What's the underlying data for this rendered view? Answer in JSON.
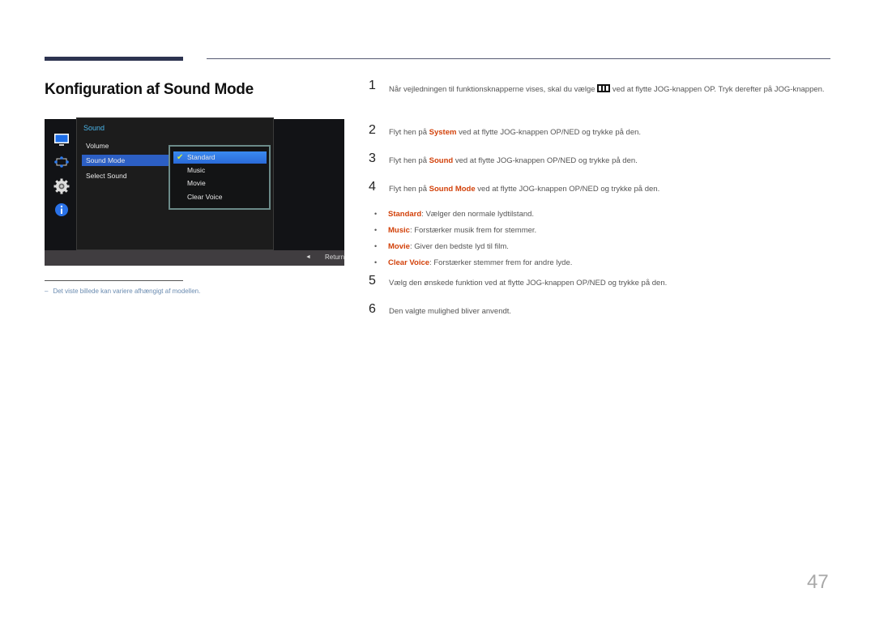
{
  "page": {
    "title": "Konfiguration af Sound Mode",
    "page_number": "47",
    "note": "Det viste billede kan variere afhængigt af modellen.",
    "note_marker": "–"
  },
  "osd": {
    "section_title": "Sound",
    "sidebar_icons": [
      "picture-icon",
      "screen-position-icon",
      "system-gear-icon",
      "information-icon"
    ],
    "menu_items": [
      {
        "label": "Volume",
        "selected": false
      },
      {
        "label": "Sound Mode",
        "selected": true
      },
      {
        "label": "Select Sound",
        "selected": false
      }
    ],
    "submenu_items": [
      {
        "label": "Standard",
        "selected": true
      },
      {
        "label": "Music",
        "selected": false
      },
      {
        "label": "Movie",
        "selected": false
      },
      {
        "label": "Clear Voice",
        "selected": false
      }
    ],
    "footer": {
      "arrow": "◄",
      "return_label": "Return"
    },
    "colors": {
      "selected": "#2c5fc4",
      "submenu_selected": "#3a8af0",
      "check": "#d8ec3a",
      "title": "#4ab4e8"
    }
  },
  "steps": [
    {
      "num": "1",
      "pre": "Når vejledningen til funktionsknapperne vises, skal du vælge ",
      "icon": "menu-grid-icon",
      "post": " ved at flytte JOG-knappen OP. Tryk derefter på JOG-knappen."
    },
    {
      "num": "2",
      "pre": "Flyt hen på ",
      "hl": "System",
      "post": " ved at flytte JOG-knappen OP/NED og trykke på den."
    },
    {
      "num": "3",
      "pre": "Flyt hen på ",
      "hl": "Sound",
      "post": " ved at flytte JOG-knappen OP/NED og trykke på den."
    },
    {
      "num": "4",
      "pre": "Flyt hen på ",
      "hl": "Sound Mode",
      "post": " ved at flytte JOG-knappen OP/NED og trykke på den."
    },
    {
      "num": "5",
      "text": "Vælg den ønskede funktion ved at flytte JOG-knappen OP/NED og trykke på den."
    },
    {
      "num": "6",
      "text": "Den valgte mulighed bliver anvendt."
    }
  ],
  "bullets": [
    {
      "term": "Standard",
      "desc": ": Vælger den normale lydtilstand."
    },
    {
      "term": "Music",
      "desc": ": Forstærker musik frem for stemmer."
    },
    {
      "term": "Movie",
      "desc": ": Giver den bedste lyd til film."
    },
    {
      "term": "Clear Voice",
      "desc": ": Forstærker stemmer frem for andre lyde."
    }
  ],
  "colors": {
    "highlight": "#d2410a",
    "accent_bar": "#2d3450",
    "note": "#6a8bb0"
  }
}
